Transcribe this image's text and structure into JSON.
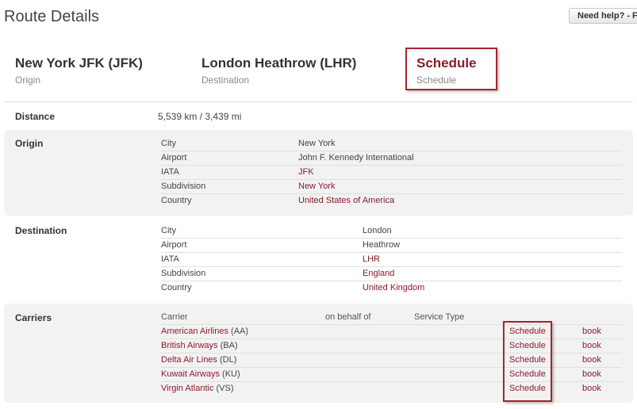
{
  "page": {
    "title": "Route Details",
    "help_label": "Need help? - F"
  },
  "route": {
    "origin": {
      "code": "New York JFK (JFK)",
      "label": "Origin"
    },
    "destination": {
      "code": "London Heathrow (LHR)",
      "label": "Destination"
    },
    "schedule": {
      "title": "Schedule",
      "label": "Schedule"
    }
  },
  "distance": {
    "label": "Distance",
    "value": "5,539 km / 3,439 mi"
  },
  "origin_section": {
    "label": "Origin",
    "rows": [
      {
        "key": "City",
        "value": "New York",
        "link": false
      },
      {
        "key": "Airport",
        "value": "John F. Kennedy International",
        "link": false
      },
      {
        "key": "IATA",
        "value": "JFK",
        "link": true
      },
      {
        "key": "Subdivision",
        "value": "New York",
        "link": true
      },
      {
        "key": "Country",
        "value": "United States of America",
        "link": true
      }
    ]
  },
  "destination_section": {
    "label": "Destination",
    "rows": [
      {
        "key": "City",
        "value": "London",
        "link": false
      },
      {
        "key": "Airport",
        "value": "Heathrow",
        "link": false
      },
      {
        "key": "IATA",
        "value": "LHR",
        "link": true
      },
      {
        "key": "Subdivision",
        "value": "England",
        "link": true
      },
      {
        "key": "Country",
        "value": "United Kingdom",
        "link": true
      }
    ]
  },
  "carriers_section": {
    "label": "Carriers",
    "columns": {
      "carrier": "Carrier",
      "behalf": "on behalf of",
      "service": "Service Type"
    },
    "rows": [
      {
        "name": "American Airlines",
        "code": "(AA)",
        "schedule": "Schedule",
        "book": "book"
      },
      {
        "name": "British Airways",
        "code": "(BA)",
        "schedule": "Schedule",
        "book": "book"
      },
      {
        "name": "Delta Air Lines",
        "code": "(DL)",
        "schedule": "Schedule",
        "book": "book"
      },
      {
        "name": "Kuwait Airways",
        "code": "(KU)",
        "schedule": "Schedule",
        "book": "book"
      },
      {
        "name": "Virgin Atlantic",
        "code": "(VS)",
        "schedule": "Schedule",
        "book": "book"
      }
    ]
  }
}
